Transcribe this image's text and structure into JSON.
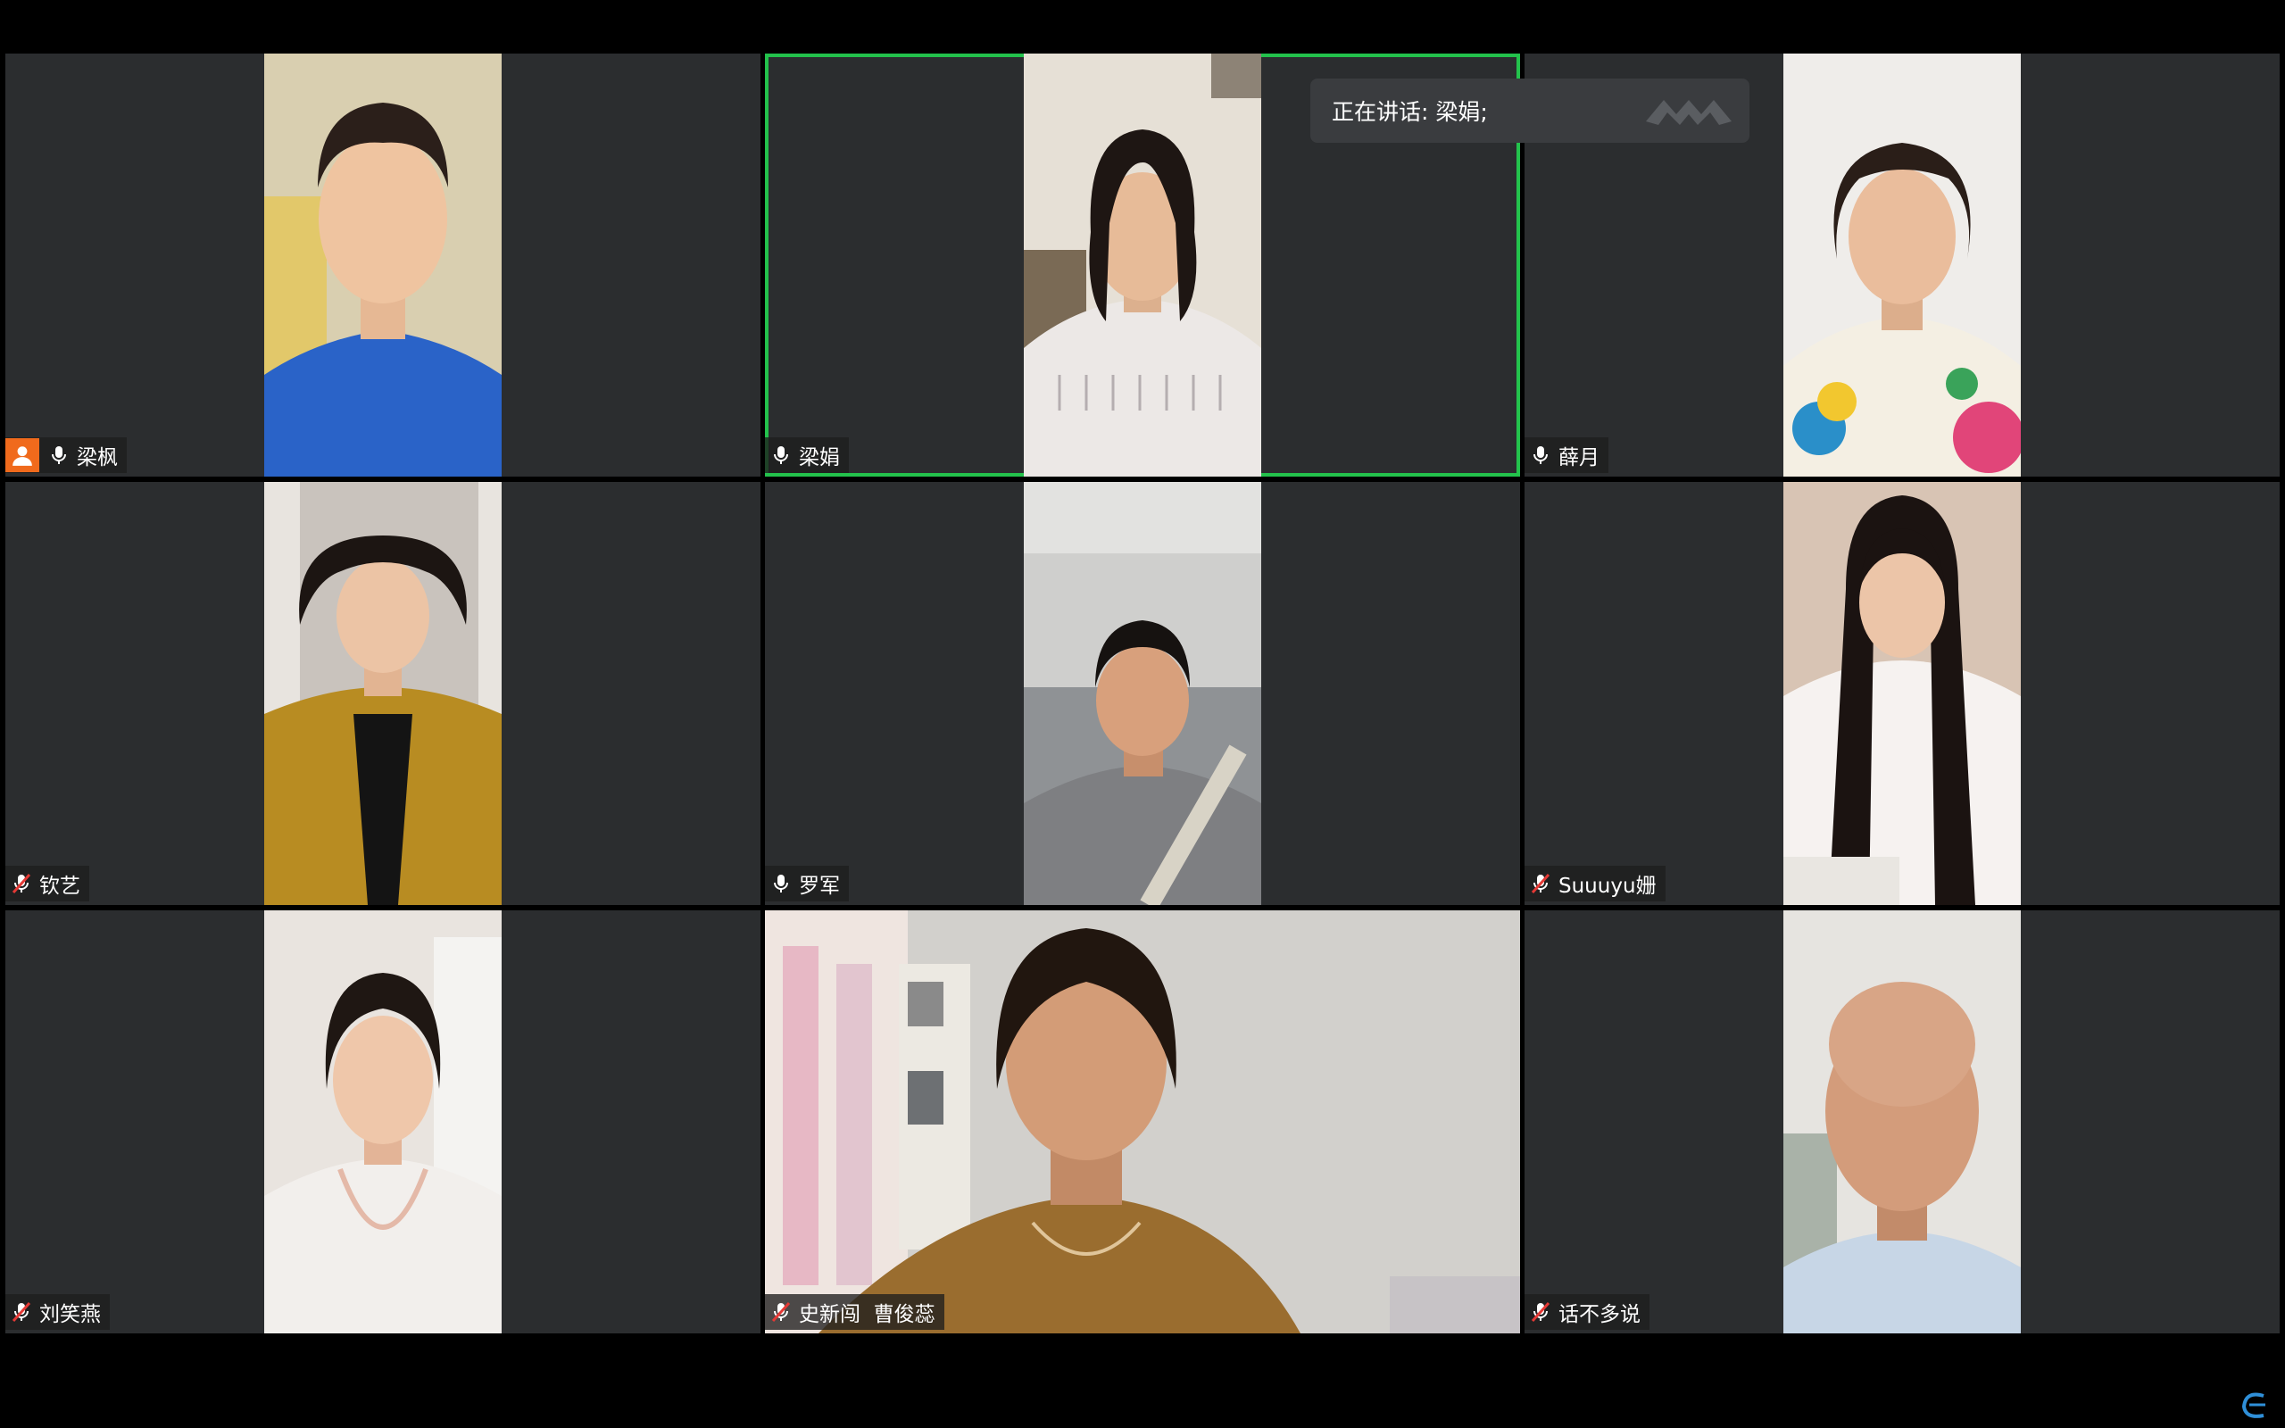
{
  "speaking": {
    "label": "正在讲话: 梁娟;"
  },
  "participants": [
    {
      "name": "梁枫",
      "mic": "on",
      "host": true
    },
    {
      "name": "梁娟",
      "mic": "on",
      "active": true
    },
    {
      "name": "薛月",
      "mic": "on"
    },
    {
      "name": "钦艺",
      "mic": "muted"
    },
    {
      "name": "罗军",
      "mic": "on"
    },
    {
      "name": "Suuuyu姗",
      "mic": "muted"
    },
    {
      "name": "刘笑燕",
      "mic": "muted"
    },
    {
      "name": "史新闯  曹俊蕊",
      "mic": "muted"
    },
    {
      "name": "话不多说",
      "mic": "muted"
    }
  ],
  "colors": {
    "active_border": "#23c24c",
    "tile_bg": "#2b2d2f",
    "host_badge": "#f06a1c"
  }
}
